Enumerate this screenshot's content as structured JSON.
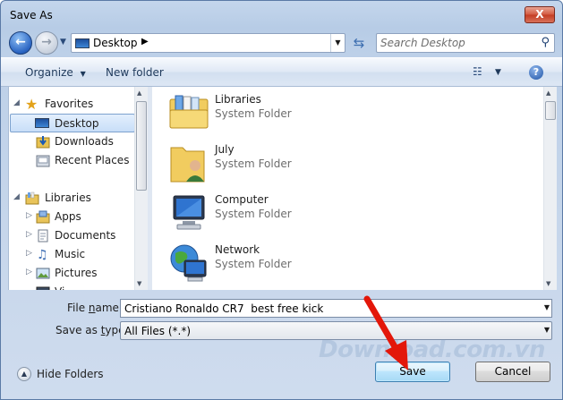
{
  "window": {
    "title": "Save As",
    "close_glyph": "X"
  },
  "nav": {
    "back_glyph": "←",
    "forward_glyph": "→",
    "history_glyph": "▼",
    "address": {
      "location": "Desktop",
      "separator": "▶",
      "dropdown_glyph": "▼",
      "icon": "desktop-icon"
    },
    "refresh_glyph": "⇆",
    "search": {
      "placeholder": "Search Desktop",
      "icon": "search-icon",
      "icon_glyph": "⚲"
    }
  },
  "toolbar": {
    "organize_label": "Organize",
    "organize_glyph": "▼",
    "new_folder_label": "New folder",
    "view_glyph": "☷",
    "view_drop_glyph": "▼",
    "help_glyph": "?"
  },
  "sidebar": {
    "favorites": {
      "label": "Favorites",
      "icon": "star-icon",
      "items": [
        {
          "label": "Desktop",
          "icon": "desktop-icon",
          "selected": true
        },
        {
          "label": "Downloads",
          "icon": "downloads-icon",
          "selected": false
        },
        {
          "label": "Recent Places",
          "icon": "recent-places-icon",
          "selected": false
        }
      ]
    },
    "libraries": {
      "label": "Libraries",
      "icon": "libraries-icon",
      "items": [
        {
          "label": "Apps",
          "icon": "apps-icon"
        },
        {
          "label": "Documents",
          "icon": "documents-icon"
        },
        {
          "label": "Music",
          "icon": "music-icon"
        },
        {
          "label": "Pictures",
          "icon": "pictures-icon"
        },
        {
          "label": "Vi",
          "icon": "videos-icon"
        }
      ]
    },
    "expand_glyph": "▷",
    "collapse_glyph": "◢"
  },
  "files": [
    {
      "name": "Libraries",
      "type": "System Folder",
      "icon": "libraries-folder-icon"
    },
    {
      "name": "July",
      "type": "System Folder",
      "icon": "user-folder-icon"
    },
    {
      "name": "Computer",
      "type": "System Folder",
      "icon": "computer-icon"
    },
    {
      "name": "Network",
      "type": "System Folder",
      "icon": "network-icon"
    }
  ],
  "form": {
    "file_name_label_a": "File ",
    "file_name_label_u": "n",
    "file_name_label_b": "ame:",
    "file_name_value": "Cristiano Ronaldo CR7  best free kick",
    "save_type_label_a": "Save as ",
    "save_type_label_u": "t",
    "save_type_label_b": "ype:",
    "save_type_value": "All Files (*.*)",
    "dropdown_glyph": "▼"
  },
  "footer": {
    "hide_folders_label": "Hide Folders",
    "hide_folders_glyph": "▲",
    "save_label": "Save",
    "cancel_label": "Cancel"
  },
  "watermark": {
    "text": "Download.com.vn"
  },
  "colors": {
    "accent": "#2a64c2",
    "arrow": "#e3170a",
    "selection": "#c8def8"
  }
}
